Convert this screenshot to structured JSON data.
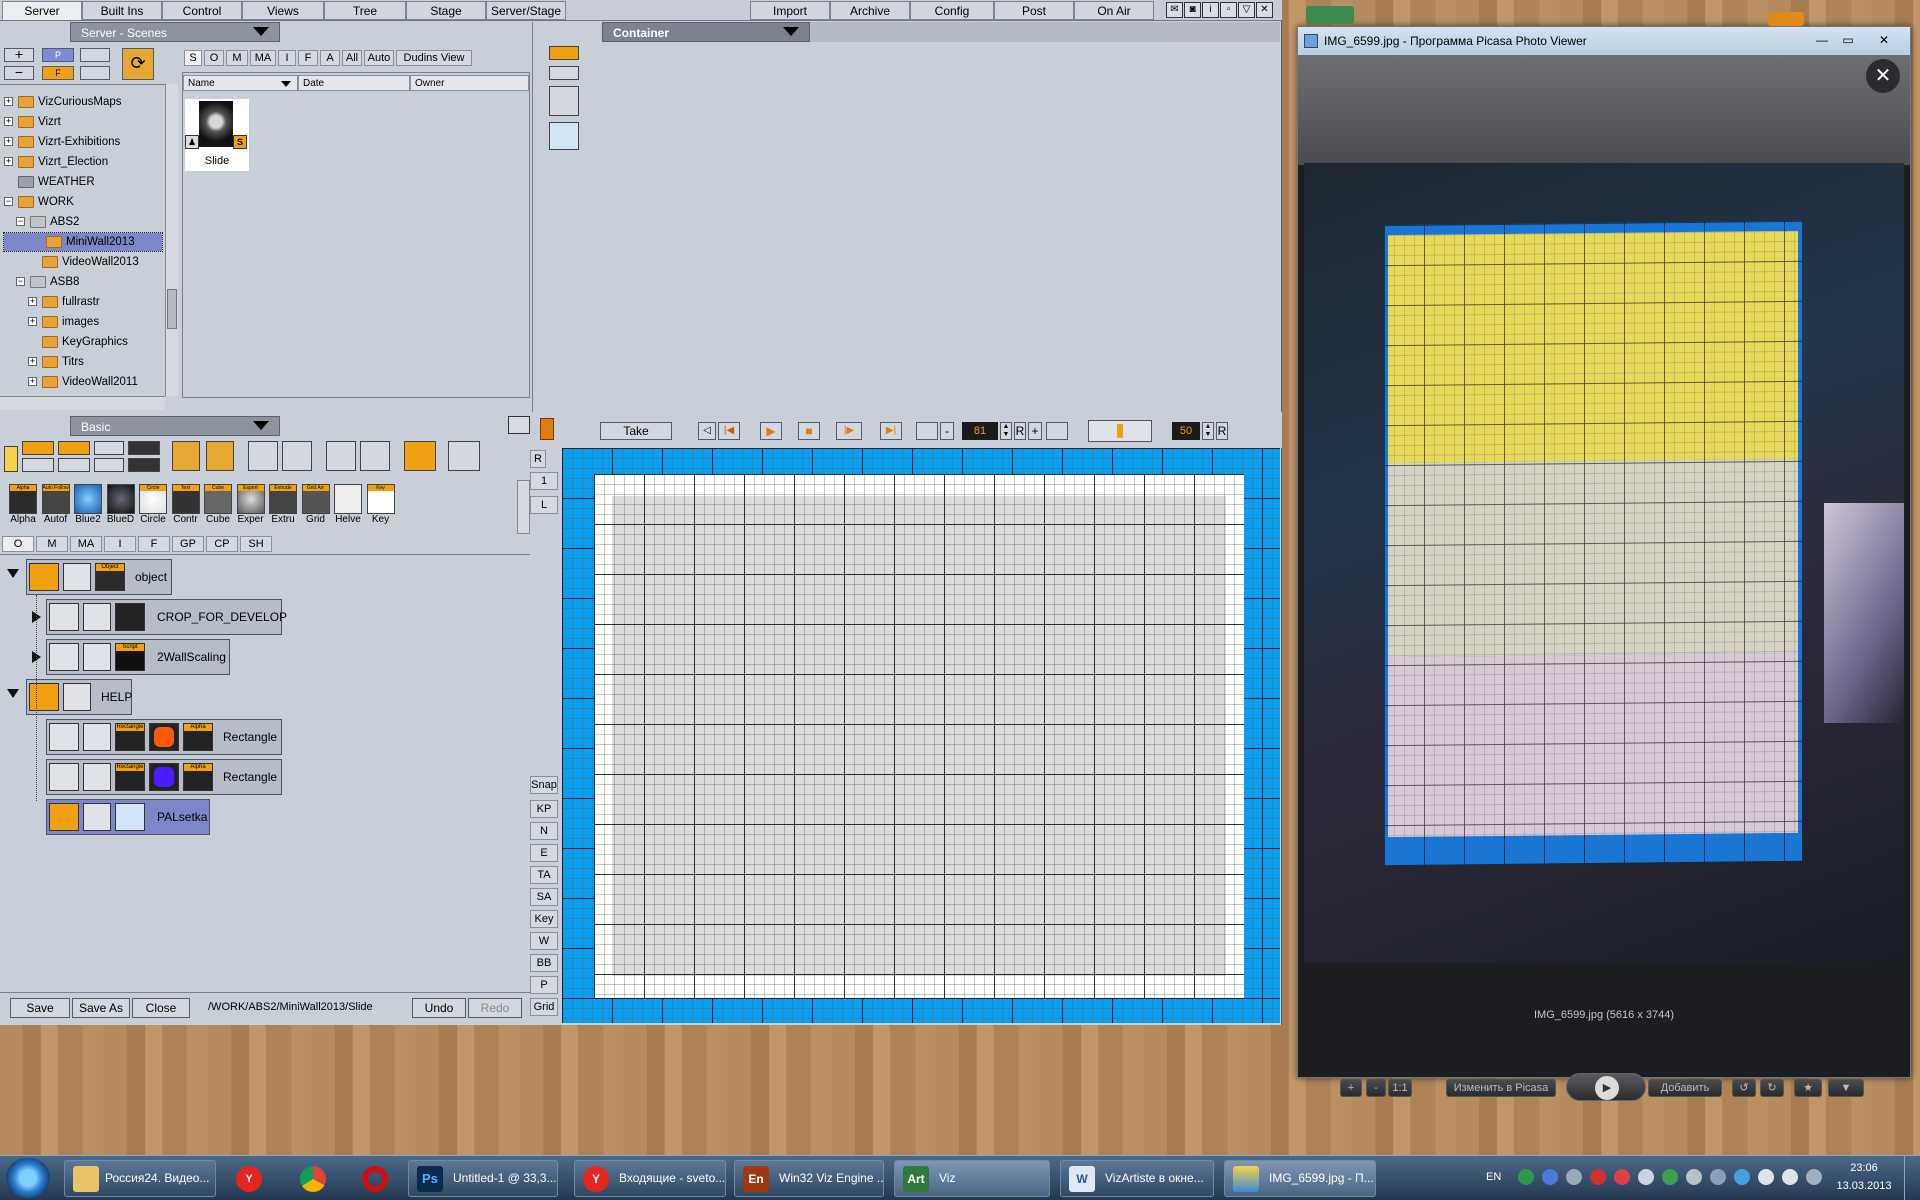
{
  "menu": {
    "items": [
      "Server",
      "Built Ins",
      "Control",
      "Views",
      "Tree",
      "Stage",
      "Server/Stage",
      "Import",
      "Archive",
      "Config",
      "Post",
      "On Air"
    ]
  },
  "server_panel": {
    "title": "Server - Scenes",
    "toolbar": {
      "p": "P",
      "f": "F",
      "plus": "+",
      "minus": "−"
    },
    "filters": [
      "S",
      "O",
      "M",
      "MA",
      "I",
      "F",
      "A",
      "All",
      "Auto",
      "Dudins View"
    ],
    "columns": [
      "Name",
      "Date",
      "Owner"
    ],
    "tree": [
      {
        "label": "VizCuriousMaps",
        "level": 0,
        "expander": "+"
      },
      {
        "label": "Vizrt",
        "level": 0,
        "expander": "+"
      },
      {
        "label": "Vizrt-Exhibitions",
        "level": 0,
        "expander": "+"
      },
      {
        "label": "Vizrt_Election",
        "level": 0,
        "expander": "+"
      },
      {
        "label": "WEATHER",
        "level": 0,
        "expander": ""
      },
      {
        "label": "WORK",
        "level": 0,
        "expander": "−"
      },
      {
        "label": "ABS2",
        "level": 1,
        "expander": "−"
      },
      {
        "label": "MiniWall2013",
        "level": 2,
        "expander": "",
        "selected": true
      },
      {
        "label": "VideoWall2013",
        "level": 2,
        "expander": ""
      },
      {
        "label": "ASB8",
        "level": 1,
        "expander": "−"
      },
      {
        "label": "fullrastr",
        "level": 2,
        "expander": "+"
      },
      {
        "label": "images",
        "level": 2,
        "expander": "+"
      },
      {
        "label": "KeyGraphics",
        "level": 2,
        "expander": ""
      },
      {
        "label": "Titrs",
        "level": 2,
        "expander": "+"
      },
      {
        "label": "VideoWall2011",
        "level": 2,
        "expander": "+"
      }
    ],
    "scene_item": {
      "label": "Slide",
      "badge": "S"
    }
  },
  "container_panel": {
    "title": "Container"
  },
  "basic_panel": {
    "title": "Basic",
    "library": [
      {
        "label": "Alpha",
        "tag": "Alpha"
      },
      {
        "label": "Autof",
        "tag": "Auto Follow"
      },
      {
        "label": "Blue2",
        "tag": ""
      },
      {
        "label": "BlueD",
        "tag": ""
      },
      {
        "label": "Circle",
        "tag": "Circle"
      },
      {
        "label": "Contr",
        "tag": "Text"
      },
      {
        "label": "Cube",
        "tag": "Cube"
      },
      {
        "label": "Exper",
        "tag": "Expert"
      },
      {
        "label": "Extru",
        "tag": "Extrude"
      },
      {
        "label": "Grid",
        "tag": "Grid Arr"
      },
      {
        "label": "Helve",
        "tag": ""
      },
      {
        "label": "Key",
        "tag": "Key"
      }
    ],
    "filter_tabs": [
      "O",
      "M",
      "MA",
      "I",
      "F",
      "GP",
      "CP",
      "SH"
    ]
  },
  "scene_tree": {
    "nodes": [
      {
        "label": "object",
        "tag": "Object"
      },
      {
        "label": "CROP_FOR_DEVELOP",
        "tag": ""
      },
      {
        "label": "2WallScaling",
        "tag": "Script"
      },
      {
        "label": "HELP",
        "tag": ""
      },
      {
        "label": "Rectangle",
        "tag": "Rectangle",
        "tag2": "Alpha",
        "color": "#ff5a00"
      },
      {
        "label": "Rectangle",
        "tag": "Rectangle",
        "tag2": "Alpha",
        "color": "#4a1cff"
      },
      {
        "label": "PALsetka",
        "tag": ""
      }
    ]
  },
  "bottom_bar": {
    "save": "Save",
    "save_as": "Save As",
    "close": "Close",
    "path": "/WORK/ABS2/MiniWall2013/Slide",
    "undo": "Undo",
    "redo": "Redo"
  },
  "transport": {
    "take": "Take",
    "frame": "81",
    "speed": "50",
    "r": "R",
    "minus": "-",
    "plus": "+"
  },
  "side_buttons": [
    "Snap",
    "KP",
    "N",
    "E",
    "TA",
    "SA",
    "Key",
    "W",
    "BB",
    "P",
    "Grid"
  ],
  "side_top": [
    "R",
    "1",
    "L"
  ],
  "picasa": {
    "title": "IMG_6599.jpg - Программа Picasa Photo Viewer",
    "caption": "IMG_6599.jpg (5616 x 3744)",
    "controls": {
      "zoom_in": "+",
      "zoom_out": "-",
      "one": "1:1",
      "edit": "Изменить в Picasa",
      "add": "Добавить"
    }
  },
  "taskbar": {
    "tasks": [
      "Россия24. Видео...",
      "Untitled-1 @ 33,3...",
      "Входящие - sveto...",
      "Win32 Viz Engine ...",
      "Viz",
      "VizArtiste в окне...",
      "IMG_6599.jpg - П..."
    ],
    "lang": "EN",
    "time": "23:06",
    "date": "13.03.2013"
  }
}
